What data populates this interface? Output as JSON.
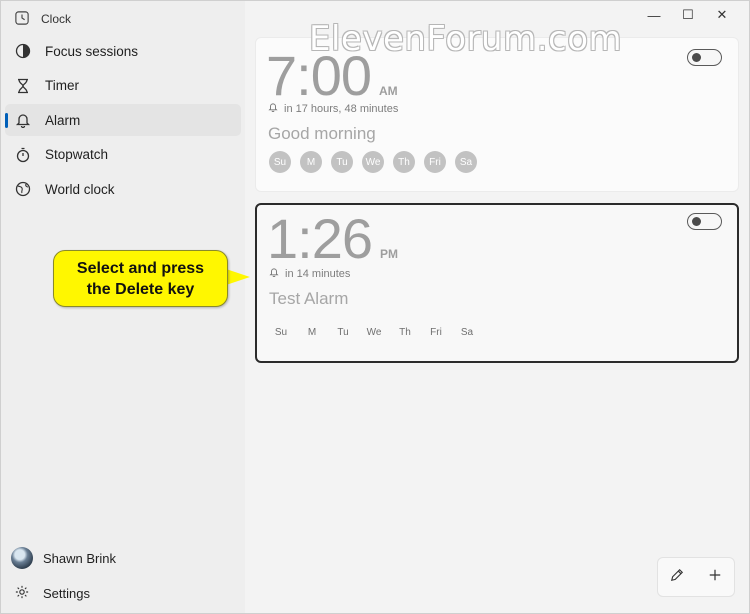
{
  "app": {
    "title": "Clock"
  },
  "window_controls": {
    "minimize": "—",
    "maximize": "☐",
    "close": "✕"
  },
  "watermark": "ElevenForum.com",
  "nav": {
    "items": [
      {
        "label": "Focus sessions",
        "icon": "focus-icon"
      },
      {
        "label": "Timer",
        "icon": "hourglass-icon"
      },
      {
        "label": "Alarm",
        "icon": "bell-icon",
        "active": true
      },
      {
        "label": "Stopwatch",
        "icon": "stopwatch-icon"
      },
      {
        "label": "World clock",
        "icon": "globe-icon"
      }
    ]
  },
  "user": {
    "name": "Shawn Brink"
  },
  "settings": {
    "label": "Settings"
  },
  "alarms": [
    {
      "time": "7:00",
      "ampm": "AM",
      "remaining": "in 17 hours, 48 minutes",
      "name": "Good morning",
      "days": [
        "Su",
        "M",
        "Tu",
        "We",
        "Th",
        "Fri",
        "Sa"
      ],
      "enabled": false
    },
    {
      "time": "1:26",
      "ampm": "PM",
      "remaining": "in 14 minutes",
      "name": "Test Alarm",
      "days": [
        "Su",
        "M",
        "Tu",
        "We",
        "Th",
        "Fri",
        "Sa"
      ],
      "enabled": false,
      "selected": true
    }
  ],
  "callout": {
    "line1": "Select and press",
    "line2": "the Delete key"
  },
  "colors": {
    "accent": "#005fb8",
    "callout_bg": "#fff700"
  }
}
